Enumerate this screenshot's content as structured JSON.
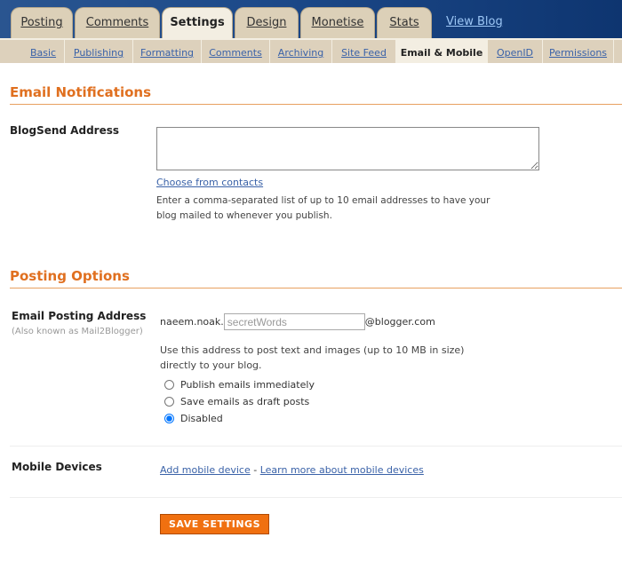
{
  "tabs": [
    {
      "label": "Posting"
    },
    {
      "label": "Comments"
    },
    {
      "label": "Settings",
      "active": true
    },
    {
      "label": "Design"
    },
    {
      "label": "Monetise"
    },
    {
      "label": "Stats"
    }
  ],
  "view_blog": "View Blog",
  "subtabs": [
    {
      "label": "Basic"
    },
    {
      "label": "Publishing"
    },
    {
      "label": "Formatting"
    },
    {
      "label": "Comments"
    },
    {
      "label": "Archiving"
    },
    {
      "label": "Site Feed"
    },
    {
      "label": "Email & Mobile",
      "active": true
    },
    {
      "label": "OpenID"
    },
    {
      "label": "Permissions"
    }
  ],
  "email_notifications": {
    "heading": "Email Notifications",
    "blogsend_label": "BlogSend Address",
    "blogsend_value": "",
    "choose_contacts": "Choose from contacts",
    "help": "Enter a comma-separated list of up to 10 email addresses to have your blog mailed to whenever you publish."
  },
  "posting_options": {
    "heading": "Posting Options",
    "email_label": "Email Posting Address",
    "email_note": "(Also known as Mail2Blogger)",
    "prefix": "naeem.noak.",
    "secret_value": "secretWords",
    "suffix": "@blogger.com",
    "help": "Use this address to post text and images (up to 10 MB in size) directly to your blog.",
    "radios": [
      {
        "label": "Publish emails immediately",
        "checked": false
      },
      {
        "label": "Save emails as draft posts",
        "checked": false
      },
      {
        "label": "Disabled",
        "checked": true
      }
    ]
  },
  "mobile": {
    "label": "Mobile Devices",
    "add_link": "Add mobile device",
    "separator": "-",
    "learn_link": "Learn more about mobile devices"
  },
  "save_button": "SAVE SETTINGS"
}
